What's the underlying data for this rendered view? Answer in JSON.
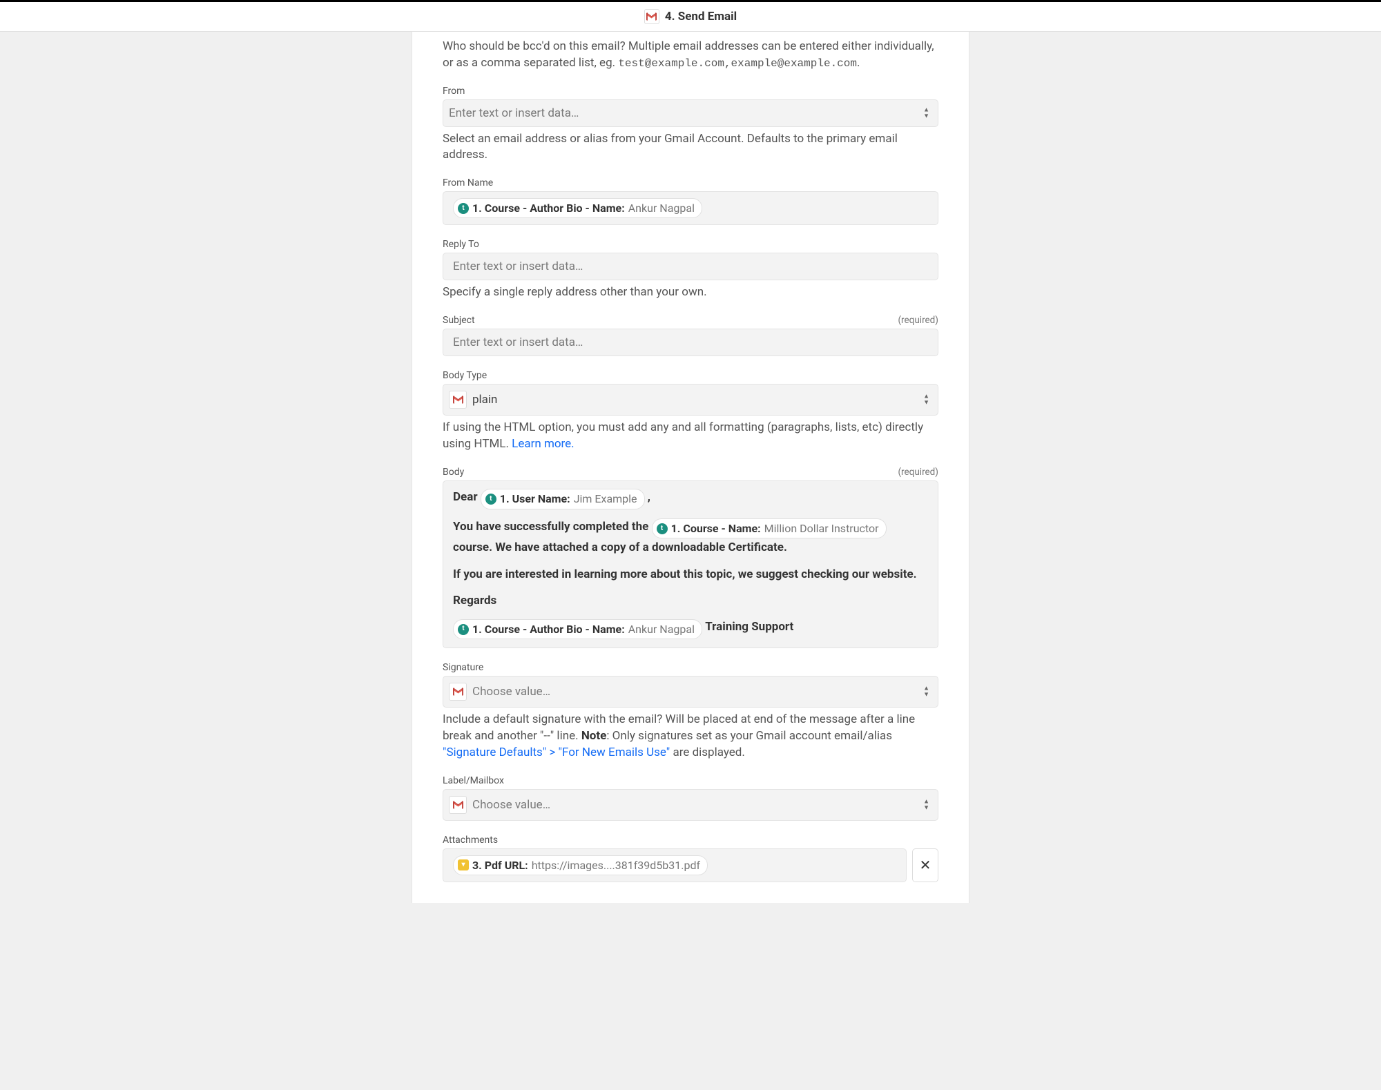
{
  "header": {
    "title": "4. Send Email"
  },
  "bcc": {
    "help_prefix": "Who should be bcc'd on this email? Multiple email addresses can be entered either individually, or as a comma separated list, eg. ",
    "help_mono": "test@example.com,example@example.com",
    "help_suffix": "."
  },
  "from": {
    "label": "From",
    "placeholder": "Enter text or insert data…",
    "help": "Select an email address or alias from your Gmail Account. Defaults to the primary email address."
  },
  "from_name": {
    "label": "From Name",
    "pill_label": "1. Course - Author Bio - Name: ",
    "pill_value": "Ankur Nagpal"
  },
  "reply_to": {
    "label": "Reply To",
    "placeholder": "Enter text or insert data…",
    "help": "Specify a single reply address other than your own."
  },
  "subject": {
    "label": "Subject",
    "required": "(required)",
    "placeholder": "Enter text or insert data…"
  },
  "body_type": {
    "label": "Body Type",
    "value": "plain",
    "help_text": "If using the HTML option, you must add any and all formatting (paragraphs, lists, etc) directly using HTML. ",
    "help_link": "Learn more."
  },
  "body": {
    "label": "Body",
    "required": "(required)",
    "line1_prefix": "Dear ",
    "pill_user_label": "1. User Name: ",
    "pill_user_value": "Jim Example",
    "line1_suffix": " ,",
    "line2_prefix": "You have successfully completed the ",
    "pill_course_label": "1. Course - Name: ",
    "pill_course_value": "Million Dollar Instructor",
    "line2_suffix": " course. We have attached a copy of a downloadable Certificate.",
    "line3": "If you are interested in learning more about this topic, we suggest checking our website.",
    "line4": "Regards",
    "pill_author_label": "1. Course - Author Bio - Name: ",
    "pill_author_value": "Ankur Nagpal",
    "line5_suffix": " Training Support"
  },
  "signature": {
    "label": "Signature",
    "placeholder": "Choose value…",
    "help_prefix": "Include a default signature with the email? Will be placed at end of the message after a line break and another \"--\" line. ",
    "help_note_label": "Note",
    "help_mid": ": Only signatures set as your Gmail account email/alias ",
    "help_link": "\"Signature Defaults\" > \"For New Emails Use\"",
    "help_suffix": " are displayed."
  },
  "label_mailbox": {
    "label": "Label/Mailbox",
    "placeholder": "Choose value…"
  },
  "attachments": {
    "label": "Attachments",
    "pill_label": "3. Pdf URL: ",
    "pill_value": "https://images....381f39d5b31.pdf"
  }
}
